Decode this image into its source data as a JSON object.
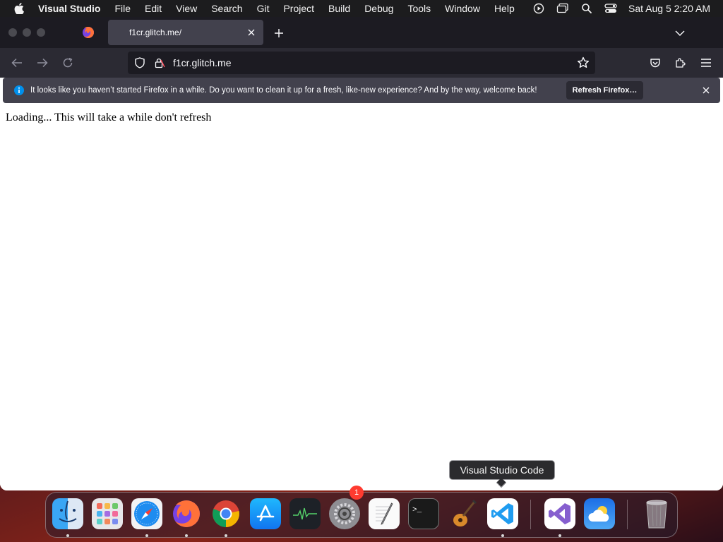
{
  "menubar": {
    "app_name": "Visual Studio",
    "items": [
      "File",
      "Edit",
      "View",
      "Search",
      "Git",
      "Project",
      "Build",
      "Debug",
      "Tools",
      "Window",
      "Help"
    ],
    "clock": "Sat Aug 5  2:20 AM"
  },
  "browser": {
    "tab_title": "f1cr.glitch.me/",
    "url": "f1cr.glitch.me",
    "notification": {
      "text": "It looks like you haven’t started Firefox in a while. Do you want to clean it up for a fresh, like-new experience? And by the way, welcome back!",
      "button_label": "Refresh Firefox…"
    },
    "page_text": "Loading... This will take a while don't refresh"
  },
  "tooltip": {
    "text": "Visual Studio Code"
  },
  "dock": {
    "badge_count": "1",
    "apps": [
      "Finder",
      "Launchpad",
      "Safari",
      "Firefox",
      "Google Chrome",
      "App Store",
      "Activity Monitor",
      "System Settings",
      "TextEdit",
      "Terminal",
      "GarageBand",
      "Visual Studio Code",
      "Visual Studio",
      "Weather",
      "Trash"
    ]
  },
  "colors": {
    "menubar_bg": "#1c1c1e",
    "tabbar_bg": "#1c1b22",
    "toolbar_bg": "#2b2a33",
    "notification_bg": "#42414d",
    "info_blue": "#0090ed",
    "badge_red": "#ff3b30"
  }
}
